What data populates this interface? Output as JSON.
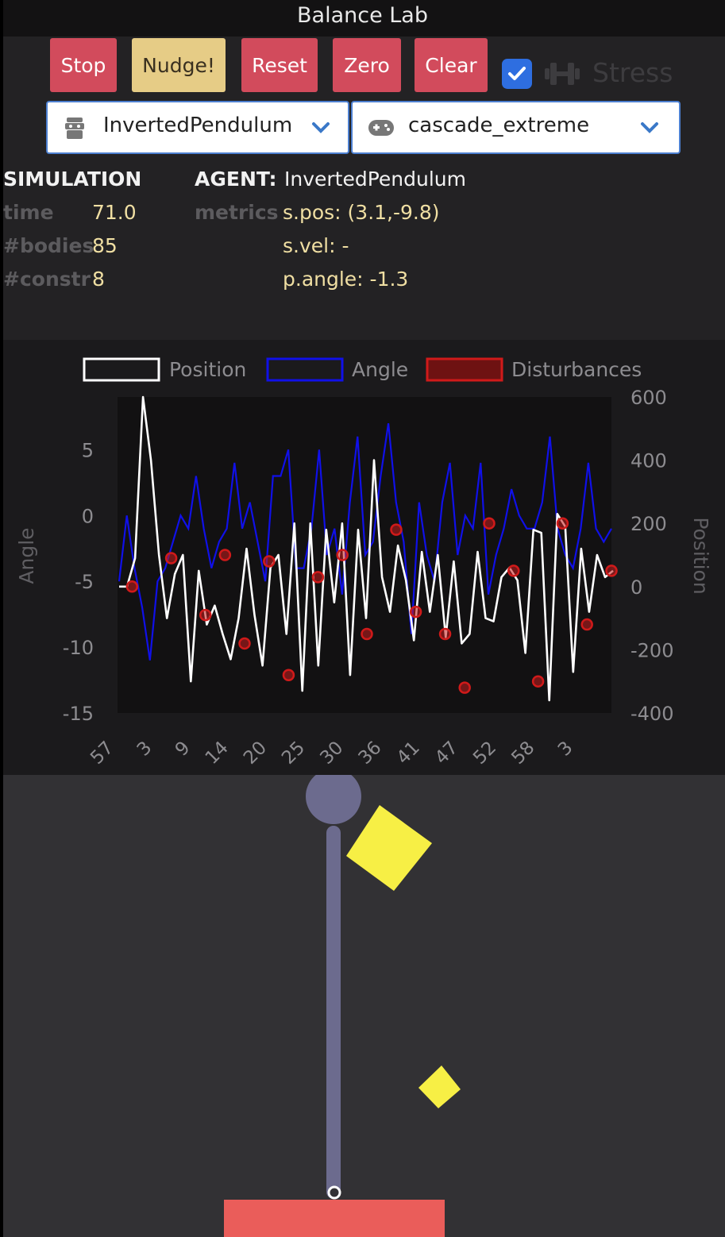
{
  "app": {
    "title": "Balance Lab"
  },
  "toolbar": {
    "stop_label": "Stop",
    "nudge_label": "Nudge!",
    "reset_label": "Reset",
    "zero_label": "Zero",
    "clear_label": "Clear",
    "stress_checked": true,
    "stress_label": "Stress"
  },
  "agent_select": {
    "value": "InvertedPendulum",
    "icon": "robot-icon"
  },
  "scenario_select": {
    "value": "cascade_extreme",
    "icon": "gamepad-icon"
  },
  "simulation": {
    "heading": "SIMULATION",
    "time_label": "time",
    "time_value": "71.0",
    "bodies_label": "#bodies",
    "bodies_value": "85",
    "constr_label": "#constr",
    "constr_value": "8"
  },
  "agent": {
    "heading": "AGENT:",
    "name": "InvertedPendulum",
    "metrics_label": "metrics",
    "pos": "s.pos: (3.1,-9.8)",
    "vel": "s.vel: -",
    "angle": "p.angle: -1.3"
  },
  "colors": {
    "button_red": "#d24b5c",
    "button_yellow": "#e6cc86",
    "position_line": "#ffffff",
    "angle_line": "#1010e8",
    "disturbance": "#d01a1a",
    "box": "#f7ef45",
    "base": "#ea5d5a",
    "pole": "#6c6b8e"
  },
  "chart_data": {
    "type": "line",
    "legend": [
      "Position",
      "Angle",
      "Disturbances"
    ],
    "legend_position": "top",
    "x_tick_labels": [
      "57",
      "3",
      "9",
      "14",
      "20",
      "25",
      "30",
      "36",
      "41",
      "47",
      "52",
      "58",
      "3"
    ],
    "y_left": {
      "label": "Angle",
      "ticks": [
        5,
        0,
        -5,
        -10,
        -15
      ],
      "range": [
        -15,
        9
      ]
    },
    "y_right": {
      "label": "Position",
      "ticks": [
        600,
        400,
        200,
        0,
        -200,
        -400
      ],
      "range": [
        -400,
        600
      ]
    },
    "series": [
      {
        "name": "Position",
        "axis": "right",
        "values": [
          0,
          0,
          90,
          600,
          400,
          100,
          -100,
          40,
          100,
          -300,
          50,
          -120,
          -60,
          -150,
          -230,
          -100,
          120,
          -90,
          -250,
          60,
          100,
          -150,
          200,
          -330,
          200,
          -250,
          180,
          -50,
          200,
          -280,
          180,
          -100,
          400,
          30,
          -80,
          130,
          20,
          -170,
          110,
          -80,
          100,
          -160,
          80,
          -180,
          -150,
          110,
          -100,
          -110,
          30,
          60,
          20,
          -210,
          180,
          170,
          -360,
          230,
          190,
          -270,
          120,
          -80,
          100,
          30,
          50
        ]
      },
      {
        "name": "Angle",
        "axis": "left",
        "values": [
          -5,
          0,
          -4,
          -7,
          -11,
          -5,
          -4,
          -2,
          0,
          -1,
          3,
          -1,
          -4,
          -2,
          -1,
          4,
          -1,
          1,
          -2,
          -5,
          3,
          3,
          5,
          -4,
          -4,
          -1,
          5,
          -3,
          -1,
          -6,
          1,
          6,
          -3,
          -2,
          3,
          7,
          1,
          -2,
          -9,
          1,
          -3,
          -5,
          1,
          4,
          -3,
          0,
          -1,
          4,
          -6,
          -3,
          -1,
          2,
          0,
          -1,
          -1,
          1,
          6,
          -1,
          -3,
          -4,
          -1,
          4,
          -1,
          -2,
          -1
        ]
      },
      {
        "name": "Disturbances",
        "axis": "right",
        "points": [
          [
            0.02,
            0
          ],
          [
            0.1,
            90
          ],
          [
            0.17,
            -90
          ],
          [
            0.21,
            100
          ],
          [
            0.25,
            -180
          ],
          [
            0.3,
            80
          ],
          [
            0.34,
            -280
          ],
          [
            0.4,
            30
          ],
          [
            0.45,
            100
          ],
          [
            0.5,
            -150
          ],
          [
            0.56,
            180
          ],
          [
            0.6,
            -80
          ],
          [
            0.66,
            -150
          ],
          [
            0.7,
            -320
          ],
          [
            0.75,
            200
          ],
          [
            0.8,
            50
          ],
          [
            0.85,
            -300
          ],
          [
            0.9,
            200
          ],
          [
            0.95,
            -120
          ],
          [
            1.0,
            50
          ]
        ]
      }
    ]
  },
  "scene": {
    "objects": [
      "pendulum-pole",
      "pendulum-bob",
      "pivot",
      "cart-base",
      "box",
      "box"
    ]
  }
}
